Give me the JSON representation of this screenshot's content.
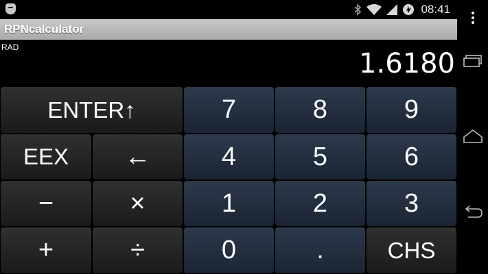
{
  "status_bar": {
    "time": "08:41",
    "icons": [
      "app-shield-icon",
      "bluetooth-icon",
      "wifi-icon",
      "signal-icon",
      "sync-icon"
    ]
  },
  "app": {
    "title": "RPNcalculator"
  },
  "display": {
    "angle_mode": "RAD",
    "value": "1.6180"
  },
  "keypad": {
    "enter": "ENTER↑",
    "eex": "EEX",
    "backspace": "←",
    "minus": "−",
    "multiply": "×",
    "plus": "+",
    "divide": "÷",
    "digits": {
      "d7": "7",
      "d8": "8",
      "d9": "9",
      "d4": "4",
      "d5": "5",
      "d6": "6",
      "d1": "1",
      "d2": "2",
      "d3": "3",
      "d0": "0"
    },
    "decimal": ".",
    "chs": "CHS"
  },
  "colors": {
    "operator_key": "#262626",
    "digit_key": "#243042",
    "title_bar": "#b8b8b8"
  },
  "nav_bar": {
    "icons": [
      "recent-apps-icon",
      "home-icon",
      "back-icon"
    ]
  }
}
